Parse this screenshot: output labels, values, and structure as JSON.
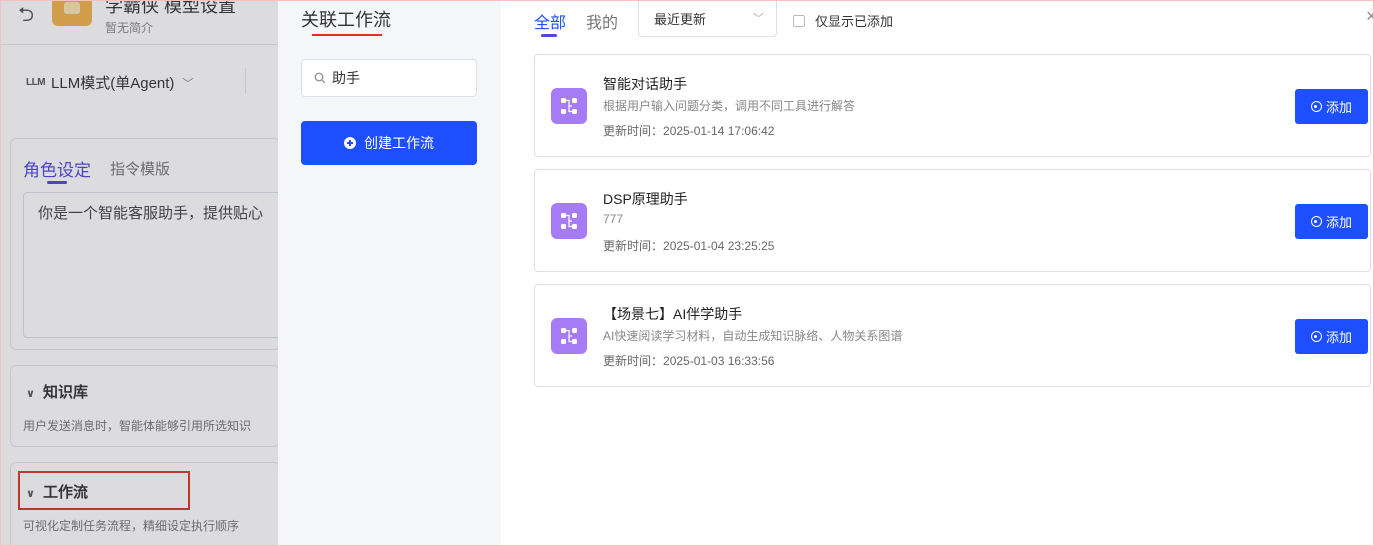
{
  "background": {
    "title": "学霸侠 模型设置",
    "subtitle": "暂无简介",
    "mode": {
      "icon_text": "LLM",
      "label": "LLM模式(单Agent)"
    },
    "tabs": [
      {
        "label": "角色设定",
        "active": true
      },
      {
        "label": "指令模版",
        "active": false
      }
    ],
    "prompt_text": "你是一个智能客服助手，提供贴心",
    "knowledge": {
      "title": "知识库",
      "desc": "用户发送消息时，智能体能够引用所选知识"
    },
    "workflow": {
      "title": "工作流",
      "desc": "可视化定制任务流程，精细设定执行顺序"
    }
  },
  "modal": {
    "title": "关联工作流",
    "search": {
      "value": "助手"
    },
    "create_label": "创建工作流",
    "tabs": [
      {
        "label": "全部",
        "active": true
      },
      {
        "label": "我的",
        "active": false
      }
    ],
    "sort": {
      "selected": "最近更新"
    },
    "only_added_label": "仅显示已添加",
    "close": "×",
    "add_label": "添加",
    "items": [
      {
        "name": "智能对话助手",
        "desc": "根据用户输入问题分类，调用不同工具进行解答",
        "time_label": "更新时间：",
        "time": "2025-01-14 17:06:42"
      },
      {
        "name": "DSP原理助手",
        "desc": "777",
        "time_label": "更新时间：",
        "time": "2025-01-04 23:25:25"
      },
      {
        "name": "【场景七】AI伴学助手",
        "desc": "AI快速阅读学习材料，自动生成知识脉络、人物关系图谱",
        "time_label": "更新时间：",
        "time": "2025-01-03 16:33:56"
      }
    ]
  },
  "colors": {
    "primary": "#1d4fff",
    "accent_purple": "#4f46e5",
    "icon_purple": "#a57cf6",
    "highlight_red": "#e0322b"
  }
}
